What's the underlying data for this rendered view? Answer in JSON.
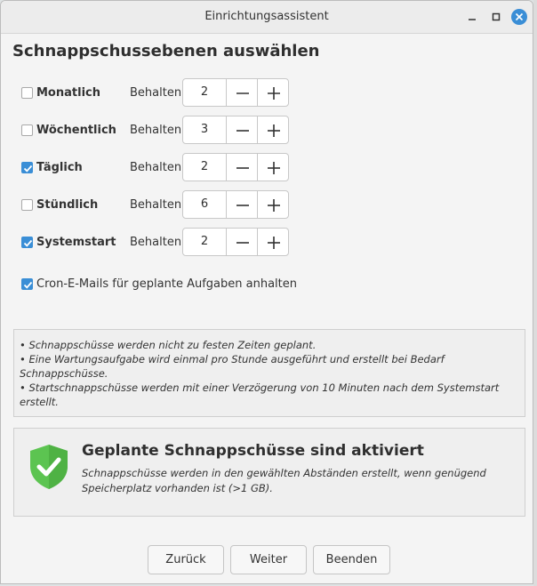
{
  "window": {
    "title": "Einrichtungsassistent"
  },
  "heading": "Schnappschussebenen auswählen",
  "keep_label": "Behalten",
  "levels": [
    {
      "label": "Monatlich",
      "checked": false,
      "value": "2"
    },
    {
      "label": "Wöchentlich",
      "checked": false,
      "value": "3"
    },
    {
      "label": "Täglich",
      "checked": true,
      "value": "2"
    },
    {
      "label": "Stündlich",
      "checked": false,
      "value": "6"
    },
    {
      "label": "Systemstart",
      "checked": true,
      "value": "2"
    }
  ],
  "cron": {
    "label": "Cron-E-Mails für geplante Aufgaben anhalten",
    "checked": true
  },
  "info": {
    "lines": [
      "• Schnappschüsse werden nicht zu festen Zeiten geplant.",
      "• Eine Wartungsaufgabe wird einmal pro Stunde ausgeführt und erstellt bei Bedarf Schnappschüsse.",
      "• Startschnappschüsse werden mit einer Verzögerung von 10 Minuten nach dem Systemstart erstellt."
    ]
  },
  "status": {
    "title": "Geplante Schnappschüsse sind aktiviert",
    "description": "Schnappschüsse werden in den gewählten Abständen erstellt, wenn genügend Speicherplatz vorhanden ist (>1 GB).",
    "icon": "shield-check-icon",
    "color": "#5cc451"
  },
  "buttons": {
    "back": "Zurück",
    "next": "Weiter",
    "finish": "Beenden"
  },
  "colors": {
    "accent": "#3a8ed6",
    "close": "#3a8ed6"
  }
}
